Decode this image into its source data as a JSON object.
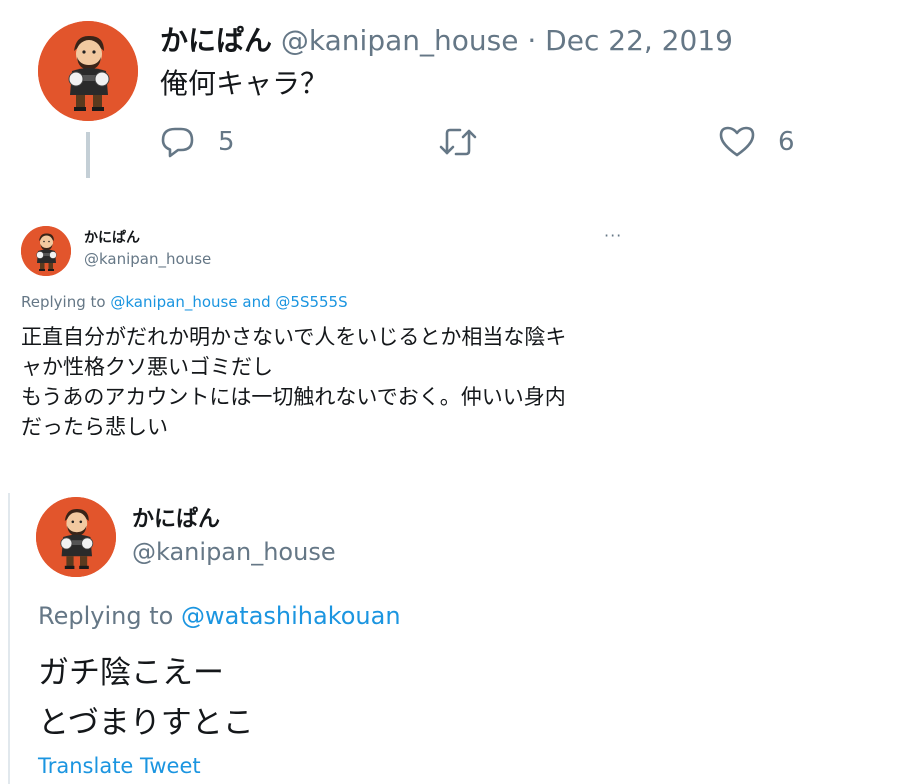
{
  "colors": {
    "avatar_bg": "#e2552c",
    "link": "#1b95e0",
    "muted": "#657786",
    "text": "#14171a"
  },
  "tweet_main": {
    "display_name": "かにぱん",
    "handle": "@kanipan_house",
    "separator": "·",
    "date": "Dec 22, 2019",
    "text": "俺何キャラ？",
    "reply_count": "5",
    "like_count": "6",
    "icons": {
      "reply": "speech-bubble-icon",
      "retweet": "retweet-icon",
      "like": "heart-icon"
    }
  },
  "tweet_reply": {
    "display_name": "かにぱん",
    "handle": "@kanipan_house",
    "more_label": "···",
    "replying_prefix": "Replying to",
    "replying_to_1": "@kanipan_house",
    "replying_and": "and",
    "replying_to_2": "@5S555S",
    "lines": [
      "正直自分がだれか明かさないで人をいじるとか相当な陰キ",
      "ャか性格クソ悪いゴミだし",
      "もうあのアカウントには一切触れないでおく。仲いい身内",
      "だったら悲しい"
    ]
  },
  "tweet_quoted": {
    "display_name": "かにぱん",
    "handle": "@kanipan_house",
    "replying_prefix": "Replying to",
    "replying_to": "@watashihakouan",
    "lines": [
      "ガチ陰こえー",
      "とづまりすとこ"
    ],
    "translate_label": "Translate Tweet"
  }
}
